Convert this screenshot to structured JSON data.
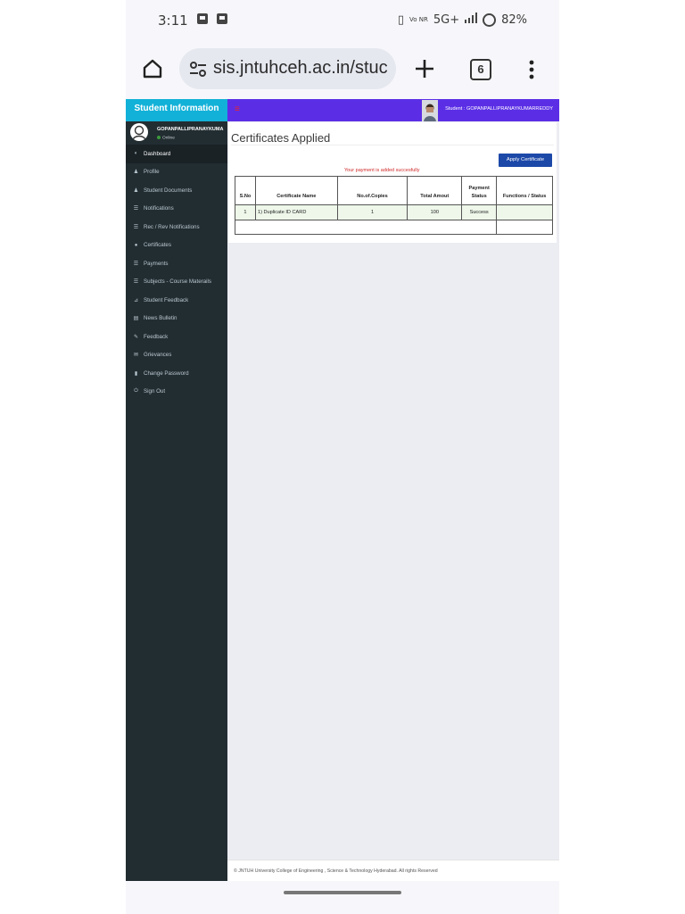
{
  "status_bar": {
    "time": "3:11",
    "network": "5G+",
    "volte": "Vo NR",
    "battery": "82%"
  },
  "browser": {
    "url": "sis.jntuhceh.ac.in/stuc",
    "tab_count": "6"
  },
  "sidebar": {
    "brand": "Student Information",
    "user_name": "GOPANPALLIPRANAYKUMA",
    "status": "Online",
    "items": [
      {
        "label": "Dashboard",
        "icon": "dashboard-icon",
        "active": true
      },
      {
        "label": "Profile",
        "icon": "user-icon"
      },
      {
        "label": "Student Documents",
        "icon": "user-icon"
      },
      {
        "label": "Notifications",
        "icon": "list-icon"
      },
      {
        "label": "Rec / Rev Notifications",
        "icon": "list-icon"
      },
      {
        "label": "Certificates",
        "icon": "circle-icon"
      },
      {
        "label": "Payments",
        "icon": "list-icon"
      },
      {
        "label": "Subjects - Course Materails",
        "icon": "list-icon"
      },
      {
        "label": "Student Feedback",
        "icon": "rss-icon"
      },
      {
        "label": "News Bulletin",
        "icon": "newspaper-icon"
      },
      {
        "label": "Feedback",
        "icon": "comments-icon"
      },
      {
        "label": "Grievances",
        "icon": "envelope-icon"
      },
      {
        "label": "Change Password",
        "icon": "lock-icon"
      },
      {
        "label": "Sign Out",
        "icon": "power-icon"
      }
    ]
  },
  "topbar": {
    "student_label": "Student : GOPANPALLIPRANAYKUMARREDDY"
  },
  "content": {
    "title": "Certificates Applied",
    "apply_button": "Apply Certificate",
    "payment_message": "Your payment is added succesfully",
    "table": {
      "headers": [
        "S.No",
        "Certificate Name",
        "No.of.Copies",
        "Total Amout",
        "Payment Status",
        "Functions / Status"
      ],
      "rows": [
        [
          "1",
          "1) Duplicate ID CARD",
          "1",
          "100",
          "Success",
          ""
        ]
      ]
    }
  },
  "footer": {
    "text": "© JNTUH University College of Engineering , Science & Technology Hyderabad. All rights Reserved"
  },
  "colors": {
    "sidebar_bg": "#222d32",
    "brand_bg": "#12b1d8",
    "topbar_bg": "#5b2ee6",
    "button_bg": "#1c48a8",
    "success_row_bg": "#eef7ea",
    "message_color": "#d12a2a"
  }
}
